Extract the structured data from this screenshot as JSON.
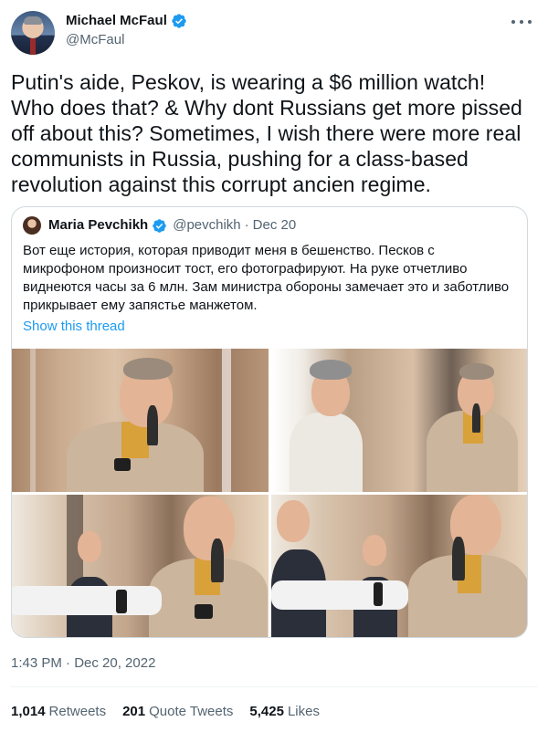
{
  "author": {
    "name": "Michael McFaul",
    "handle": "@McFaul",
    "verified": true,
    "avatar_icon": "avatar-photo"
  },
  "tweet": {
    "text": "Putin's aide, Peskov, is wearing a $6 million watch! Who does that? & Why dont Russians get more pissed off about this? Sometimes, I wish there were more real communists in Russia, pushing for a class-based revolution against this corrupt ancien regime.",
    "timestamp": "1:43 PM · Dec 20, 2022"
  },
  "quoted": {
    "name": "Maria Pevchikh",
    "handle": "@pevchikh",
    "separator": "·",
    "date": "Dec 20",
    "text": "Вот еще история, которая приводит меня в бешенство. Песков с микрофоном произносит тост, его фотографируют. На руке отчетливо виднеются часы за 6 млн. Зам министра обороны замечает это и заботливо прикрывает ему запястье манжетом.",
    "show_thread": "Show this thread"
  },
  "stats": {
    "retweets_count": "1,014",
    "retweets_label": "Retweets",
    "quotes_count": "201",
    "quotes_label": "Quote Tweets",
    "likes_count": "5,425",
    "likes_label": "Likes"
  },
  "colors": {
    "text": "#0f1419",
    "secondary": "#536471",
    "link": "#1d9bf0",
    "border": "#cfd9de",
    "verified": "#1d9bf0"
  }
}
